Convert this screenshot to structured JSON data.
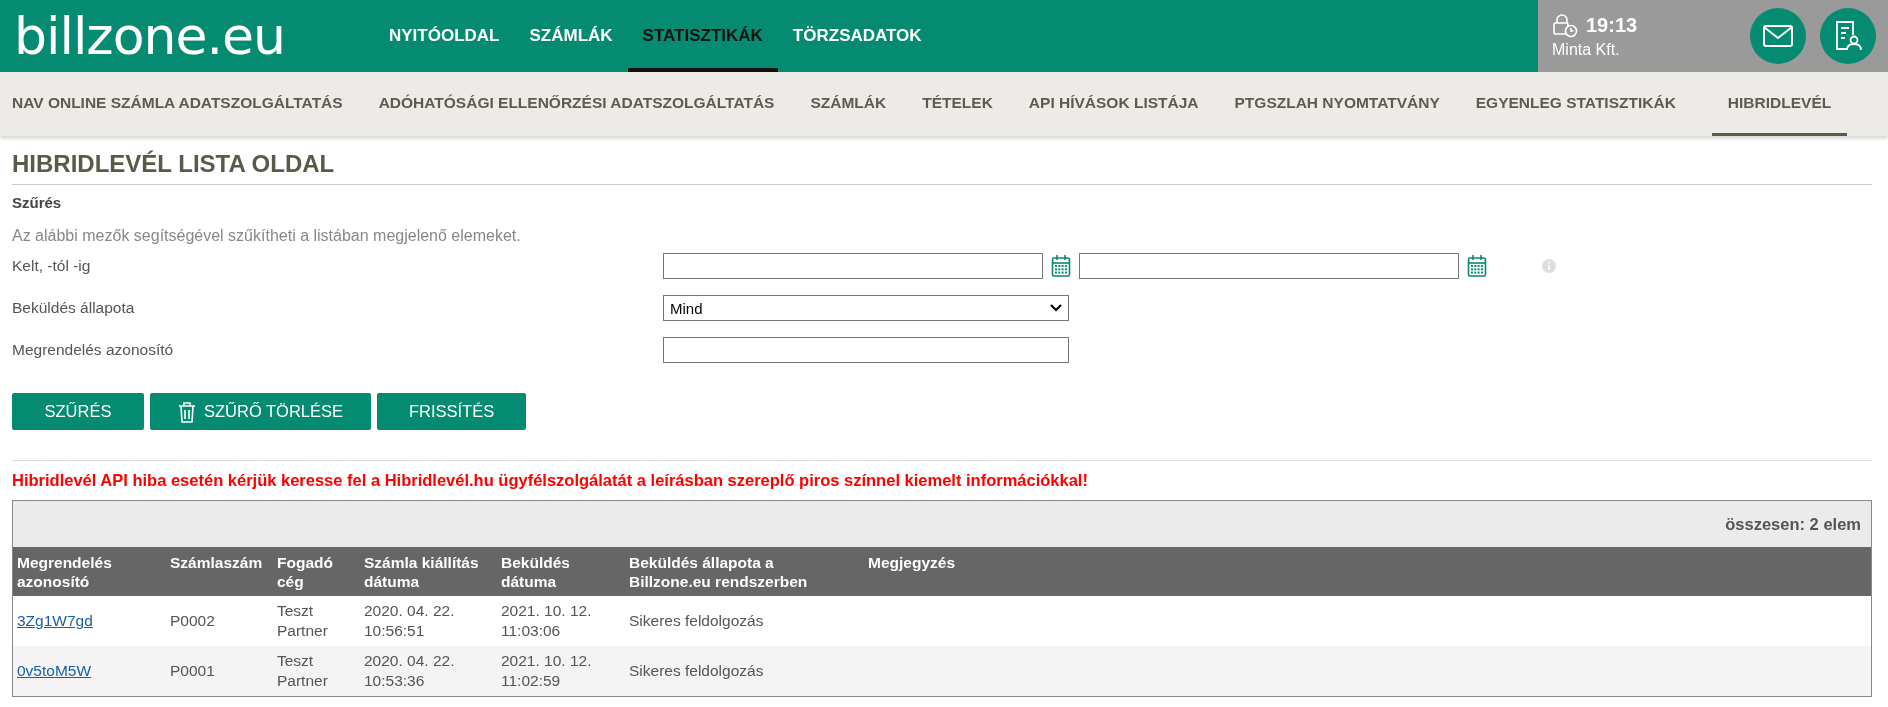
{
  "header": {
    "logo": "billzone.eu",
    "nav": [
      {
        "label": "NYITÓOLDAL",
        "selected": false
      },
      {
        "label": "SZÁMLÁK",
        "selected": false
      },
      {
        "label": "STATISZTIKÁK",
        "selected": true
      },
      {
        "label": "TÖRZSADATOK",
        "selected": false
      }
    ],
    "session_time": "19:13",
    "company": "Minta Kft."
  },
  "subnav": [
    {
      "label": "NAV ONLINE SZÁMLA ADATSZOLGÁLTATÁS",
      "selected": false
    },
    {
      "label": "ADÓHATÓSÁGI ELLENŐRZÉSI ADATSZOLGÁLTATÁS",
      "selected": false
    },
    {
      "label": "SZÁMLÁK",
      "selected": false
    },
    {
      "label": "TÉTELEK",
      "selected": false
    },
    {
      "label": "API HÍVÁSOK LISTÁJA",
      "selected": false
    },
    {
      "label": "PTGSZLAH NYOMTATVÁNY",
      "selected": false
    },
    {
      "label": "EGYENLEG STATISZTIKÁK",
      "selected": false
    },
    {
      "label": "HIBRIDLEVÉL",
      "selected": true
    }
  ],
  "page_title": "HIBRIDLEVÉL LISTA OLDAL",
  "filter": {
    "title": "Szűrés",
    "description": "Az alábbi mezők segítségével szűkítheti a listában megjelenő elemeket.",
    "fields": [
      {
        "kind": "date-range",
        "label": "Kelt, -tól -ig"
      },
      {
        "kind": "select",
        "label": "Beküldés állapota",
        "value": "Mind"
      },
      {
        "kind": "text",
        "label": "Megrendelés azonosító"
      }
    ],
    "buttons": [
      {
        "kind": "plain",
        "label": "SZŰRÉS"
      },
      {
        "kind": "trash",
        "label": "SZŰRŐ TÖRLÉSE"
      },
      {
        "kind": "plain",
        "label": "FRISSÍTÉS"
      }
    ]
  },
  "notice": "Hibridlevél API hiba esetén kérjük keresse fel a Hibridlevél.hu ügyfélszolgálatát a leírásban szereplő piros színnel kiemelt információkkal!",
  "table": {
    "total": "összesen: 2 elem",
    "columns": [
      [
        "Megrendelés",
        "azonosító"
      ],
      [
        "Számlaszám"
      ],
      [
        "Fogadó",
        "cég"
      ],
      [
        "Számla kiállítás",
        "dátuma"
      ],
      [
        "Beküldés",
        "dátuma"
      ],
      [
        "Beküldés állapota a",
        "Billzone.eu rendszerben"
      ],
      [
        "Megjegyzés"
      ]
    ],
    "rows": [
      {
        "order_id": "3Zg1W7gd",
        "invoice": "P0002",
        "recipient": [
          "Teszt",
          "Partner"
        ],
        "issued": [
          "2020. 04. 22.",
          "10:56:51"
        ],
        "submitted": [
          "2021. 10. 12.",
          "11:03:06"
        ],
        "status": "Sikeres feldolgozás"
      },
      {
        "order_id": "0v5toM5W",
        "invoice": "P0001",
        "recipient": [
          "Teszt",
          "Partner"
        ],
        "issued": [
          "2020. 04. 22.",
          "10:53:36"
        ],
        "submitted": [
          "2021. 10. 12.",
          "11:02:59"
        ],
        "status": "Sikeres feldolgozás"
      }
    ]
  }
}
